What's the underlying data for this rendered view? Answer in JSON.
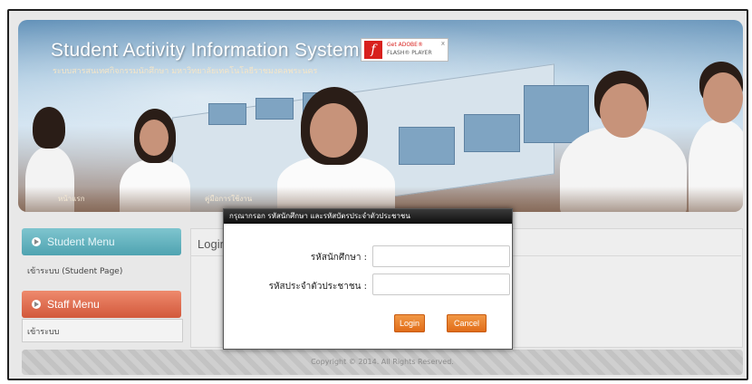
{
  "header": {
    "title": "Student Activity Information System",
    "subtitle": "ระบบสารสนเทศกิจกรรมนักศึกษา มหาวิทยาลัยเทคโนโลยีราชมงคลพระนคร",
    "flash_badge": {
      "line1": "Get ADOBE®",
      "line2": "FLASH® PLAYER",
      "close": "x",
      "logo": "f"
    },
    "nav_items": [
      "หน้าแรก",
      "คู่มือการใช้งาน"
    ]
  },
  "sidebar": {
    "student_menu_label": "Student Menu",
    "student_link": "เข้าระบบ (Student Page)",
    "staff_menu_label": "Staff Menu",
    "staff_link": "เข้าระบบ"
  },
  "content": {
    "title": "Login"
  },
  "footer": {
    "copyright": "Copyright © 2014. All Rights Reserved."
  },
  "login_dialog": {
    "title": "กรุณากรอก รหัสนักศึกษา และรหัสบัตรประจำตัวประชาชน",
    "student_id_label": "รหัสนักศึกษา :",
    "student_id_value": "",
    "citizen_id_label": "รหัสประจำตัวประชาชน :",
    "citizen_id_value": "",
    "login_label": "Login",
    "cancel_label": "Cancel"
  },
  "colors": {
    "student_menu": "#4fa3b1",
    "staff_menu": "#d2583b",
    "button": "#e06a16",
    "dialog_bar": "#111111"
  }
}
